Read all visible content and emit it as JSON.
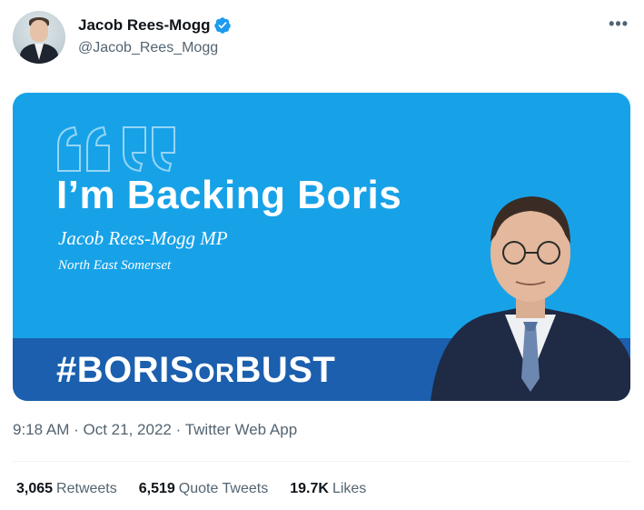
{
  "author": {
    "display_name": "Jacob Rees-Mogg",
    "handle": "@Jacob_Rees_Mogg",
    "verified": true
  },
  "more_menu": {
    "icon": "more-horizontal-icon"
  },
  "media": {
    "headline": "I’m Backing Boris",
    "mp_name": "Jacob Rees-Mogg MP",
    "constituency": "North East Somerset",
    "hashtag_part1": "#BORIS",
    "hashtag_part2": "OR",
    "hashtag_part3": "BUST",
    "colors": {
      "background": "#17a2e8",
      "banner": "#1b5fae"
    }
  },
  "meta": {
    "time": "9:18 AM",
    "separator": "·",
    "date": "Oct 21, 2022",
    "source": "Twitter Web App"
  },
  "stats": [
    {
      "value": "3,065",
      "label": "Retweets"
    },
    {
      "value": "6,519",
      "label": "Quote Tweets"
    },
    {
      "value": "19.7K",
      "label": "Likes"
    }
  ],
  "colors": {
    "verified": "#1d9bf0",
    "secondary_text": "#536471"
  }
}
